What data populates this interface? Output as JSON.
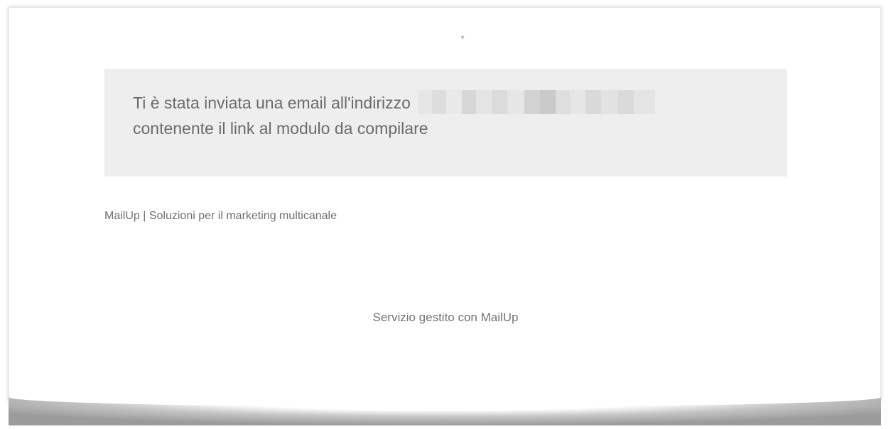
{
  "notice": {
    "line1": "Ti è stata inviata una email all'indirizzo",
    "line2": "contenente il link al modulo da compilare"
  },
  "footer": {
    "site_link": "MailUp | Soluzioni per il marketing multicanale",
    "service": "Servizio gestito con MailUp"
  },
  "colors": {
    "notice_background": "#eeeeee",
    "text": "#6b6b6b"
  },
  "icons": {
    "logo": "broken-logo-icon"
  }
}
